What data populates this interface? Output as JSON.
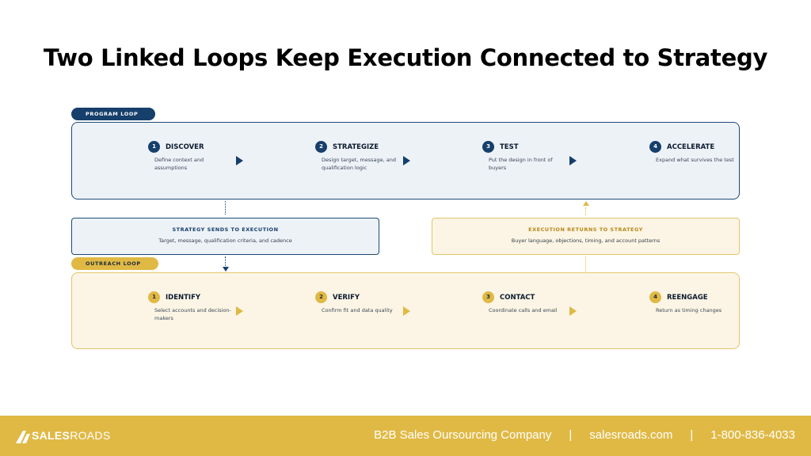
{
  "title": "Two Linked Loops Keep Execution Connected to Strategy",
  "program_loop": {
    "label": "PROGRAM LOOP",
    "steps": [
      {
        "num": "1",
        "name": "DISCOVER",
        "desc": "Define context and assumptions"
      },
      {
        "num": "2",
        "name": "STRATEGIZE",
        "desc": "Design target, message, and qualification logic"
      },
      {
        "num": "3",
        "name": "TEST",
        "desc": "Put the design in front of buyers"
      },
      {
        "num": "4",
        "name": "ACCELERATE",
        "desc": "Expand what survives the test"
      }
    ]
  },
  "strategy_to_execution": {
    "title": "STRATEGY SENDS TO EXECUTION",
    "text": "Target, message, qualification criteria, and cadence"
  },
  "execution_to_strategy": {
    "title": "EXECUTION RETURNS TO STRATEGY",
    "text": "Buyer language, objections, timing, and account patterns"
  },
  "outreach_loop": {
    "label": "OUTREACH LOOP",
    "steps": [
      {
        "num": "1",
        "name": "IDENTIFY",
        "desc": "Select accounts and decision-makers"
      },
      {
        "num": "2",
        "name": "VERIFY",
        "desc": "Confirm fit and data quality"
      },
      {
        "num": "3",
        "name": "CONTACT",
        "desc": "Coordinate calls and email"
      },
      {
        "num": "4",
        "name": "REENGAGE",
        "desc": "Return as timing changes"
      }
    ]
  },
  "footer": {
    "logo_bold": "SALES",
    "logo_light": "ROADS",
    "tagline": "B2B Sales Oursourcing Company",
    "separator": "|",
    "website": "salesroads.com",
    "phone": "1-800-836-4033"
  },
  "colors": {
    "navy": "#163f6b",
    "gold": "#e0b945",
    "program_bg": "#edf2f7",
    "outreach_bg": "#fcf5e5"
  }
}
